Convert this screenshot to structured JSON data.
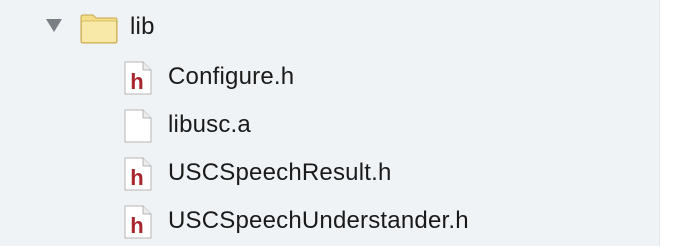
{
  "navigator": {
    "folder": {
      "name": "lib",
      "expanded": true,
      "icon": "folder-icon"
    },
    "files": [
      {
        "name": "Configure.h",
        "icon": "header-file-icon"
      },
      {
        "name": "libusc.a",
        "icon": "generic-file-icon"
      },
      {
        "name": "USCSpeechResult.h",
        "icon": "header-file-icon"
      },
      {
        "name": "USCSpeechUnderstander.h",
        "icon": "header-file-icon"
      }
    ]
  },
  "colors": {
    "background": "#f0f3f6",
    "header_icon_letter": "#a8262b",
    "folder_fill": "#f6e59a",
    "disclosure": "#7a7f85"
  }
}
